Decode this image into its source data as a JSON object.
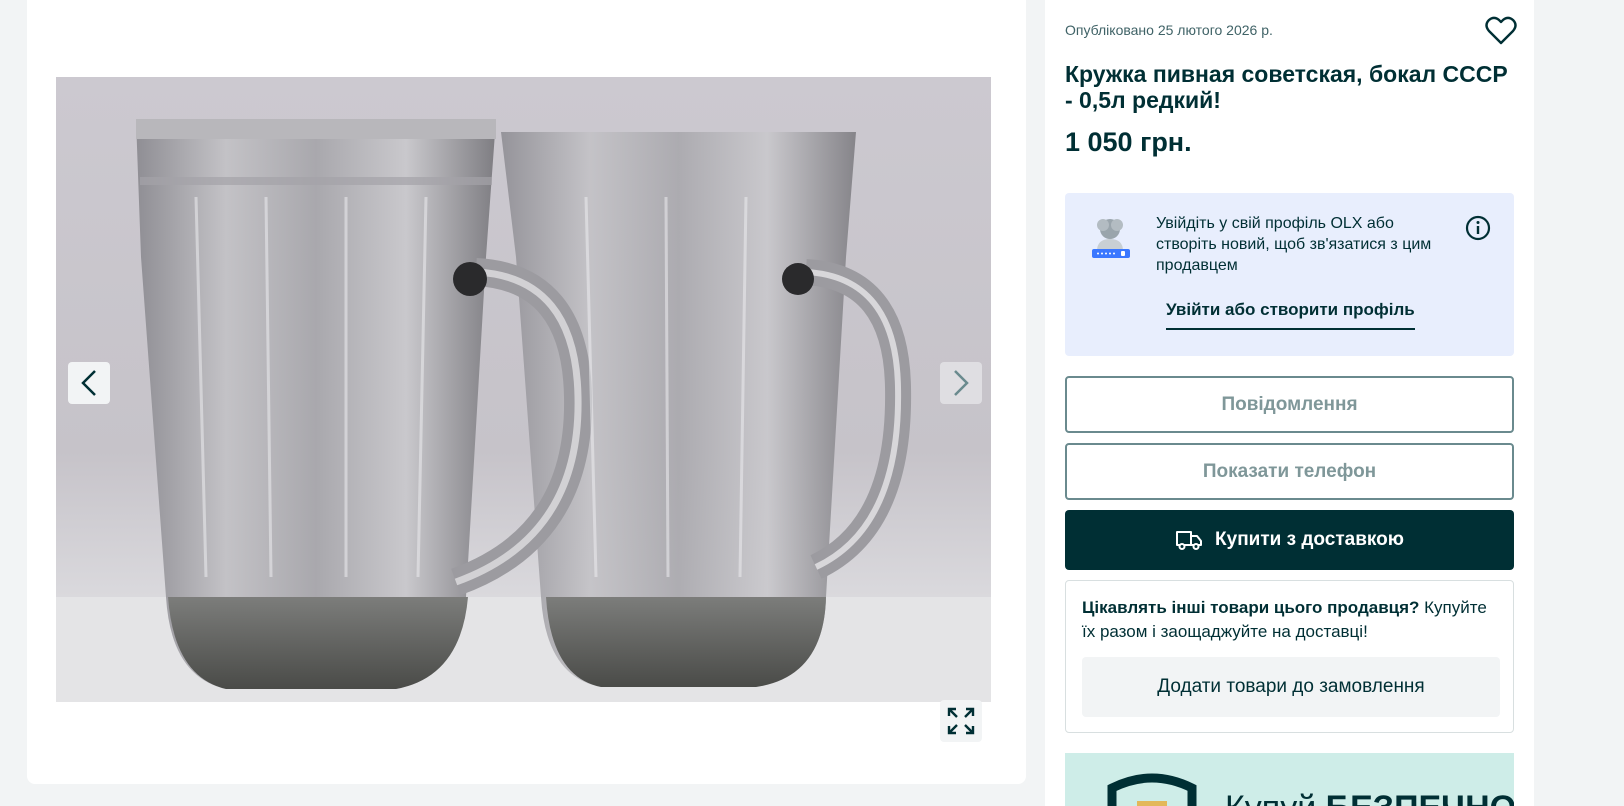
{
  "gallery": {
    "prev_icon": "chevron-left-icon",
    "next_icon": "chevron-right-icon",
    "expand_icon": "expand-icon"
  },
  "listing": {
    "published": "Опубліковано 25 лютого 2026 р.",
    "title": "Кружка пивная советская, бокал СССР - 0,5л редкий!",
    "price": "1 050 грн.",
    "favorite_icon": "heart-outline-icon"
  },
  "login": {
    "text": "Увійдіть у свій профіль OLX або створіть новий, щоб зв'язатися з цим продавцем",
    "link": "Увійти або створити профіль",
    "info_icon": "info-icon"
  },
  "actions": {
    "message": "Повідомлення",
    "phone": "Показати телефон",
    "buy": "Купити з доставкою",
    "buy_icon": "delivery-truck-icon"
  },
  "promo": {
    "bold": "Цікавлять інші товари цього продавця?",
    "rest": " Купуйте їх разом і заощаджуйте на доставці!",
    "button": "Додати товари до замовлення"
  },
  "banner": {
    "text_regular": "Купуй ",
    "text_bold": "БЕЗПЕЧНО"
  },
  "colors": {
    "brand_dark": "#002f34",
    "login_bg": "#e8eefd",
    "banner_bg": "#ceede8"
  }
}
